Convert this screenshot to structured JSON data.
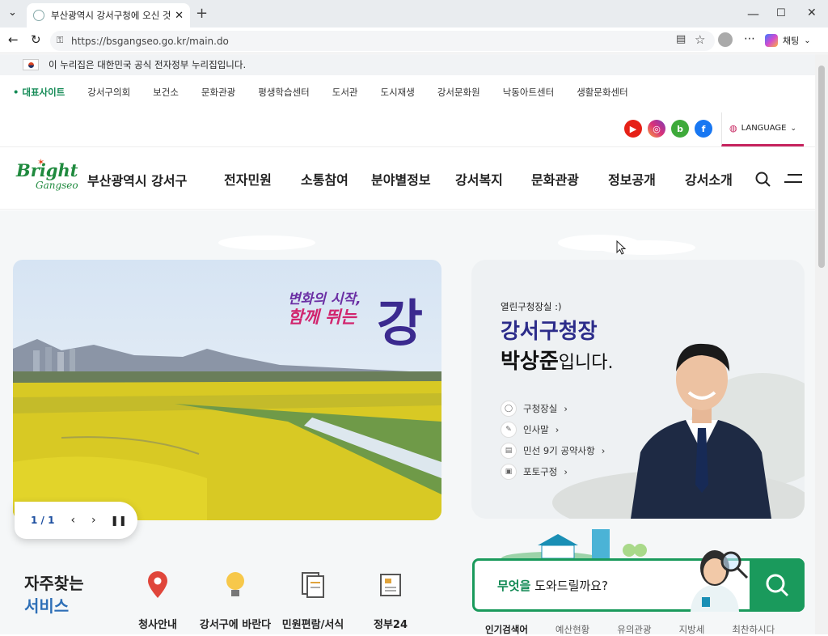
{
  "browser": {
    "tab_title": "부산광역시 강서구청에 오신 것을",
    "url": "https://bsgangseo.go.kr/main.do",
    "copilot_label": "채팅"
  },
  "gov_banner": {
    "text": "이 누리집은 대한민국 공식 전자정부 누리집입니다."
  },
  "site_nav": {
    "items": [
      "대표사이트",
      "강서구의회",
      "보건소",
      "문화관광",
      "평생학습센터",
      "도서관",
      "도시재생",
      "강서문화원",
      "낙동아트센터",
      "생활문화센터"
    ]
  },
  "social": {
    "youtube": "youtube",
    "instagram": "instagram",
    "blog": "b",
    "facebook": "f"
  },
  "language": {
    "label": "LANGUAGE"
  },
  "header": {
    "logo_main": "Bright",
    "logo_sub": "Gangseo",
    "site_name": "부산광역시 강서구",
    "menu": [
      "전자민원",
      "소통참여",
      "분야별정보",
      "강서복지",
      "문화관광",
      "정보공개",
      "강서소개"
    ]
  },
  "slider": {
    "slogan_line1": "변화의 시작,",
    "slogan_line2": "함께 뛰는",
    "slogan_big": "강",
    "counter": "1 / 1"
  },
  "mayor": {
    "greeting": "열린구청장실 :)",
    "title": "강서구청장",
    "name": "박상준",
    "suffix": "입니다.",
    "links": [
      "구청장실",
      "인사말",
      "민선 9기 공약사항",
      "포토구정"
    ]
  },
  "search": {
    "placeholder_keyword": "무엇을",
    "placeholder_rest": " 도와드릴까요?"
  },
  "keywords": {
    "tabs": [
      "인기검색어",
      "예산현황",
      "유의관광",
      "지방세",
      "최찬하시다"
    ]
  },
  "services": {
    "title_line1": "자주찾는",
    "title_line2": "서비스",
    "items": [
      "청사안내",
      "강서구에 바란다",
      "민원편람/서식",
      "정부24"
    ]
  },
  "colors": {
    "brand_green": "#1a9a5c",
    "accent_pink": "#c6235e",
    "title_blue": "#2c2c8a"
  }
}
